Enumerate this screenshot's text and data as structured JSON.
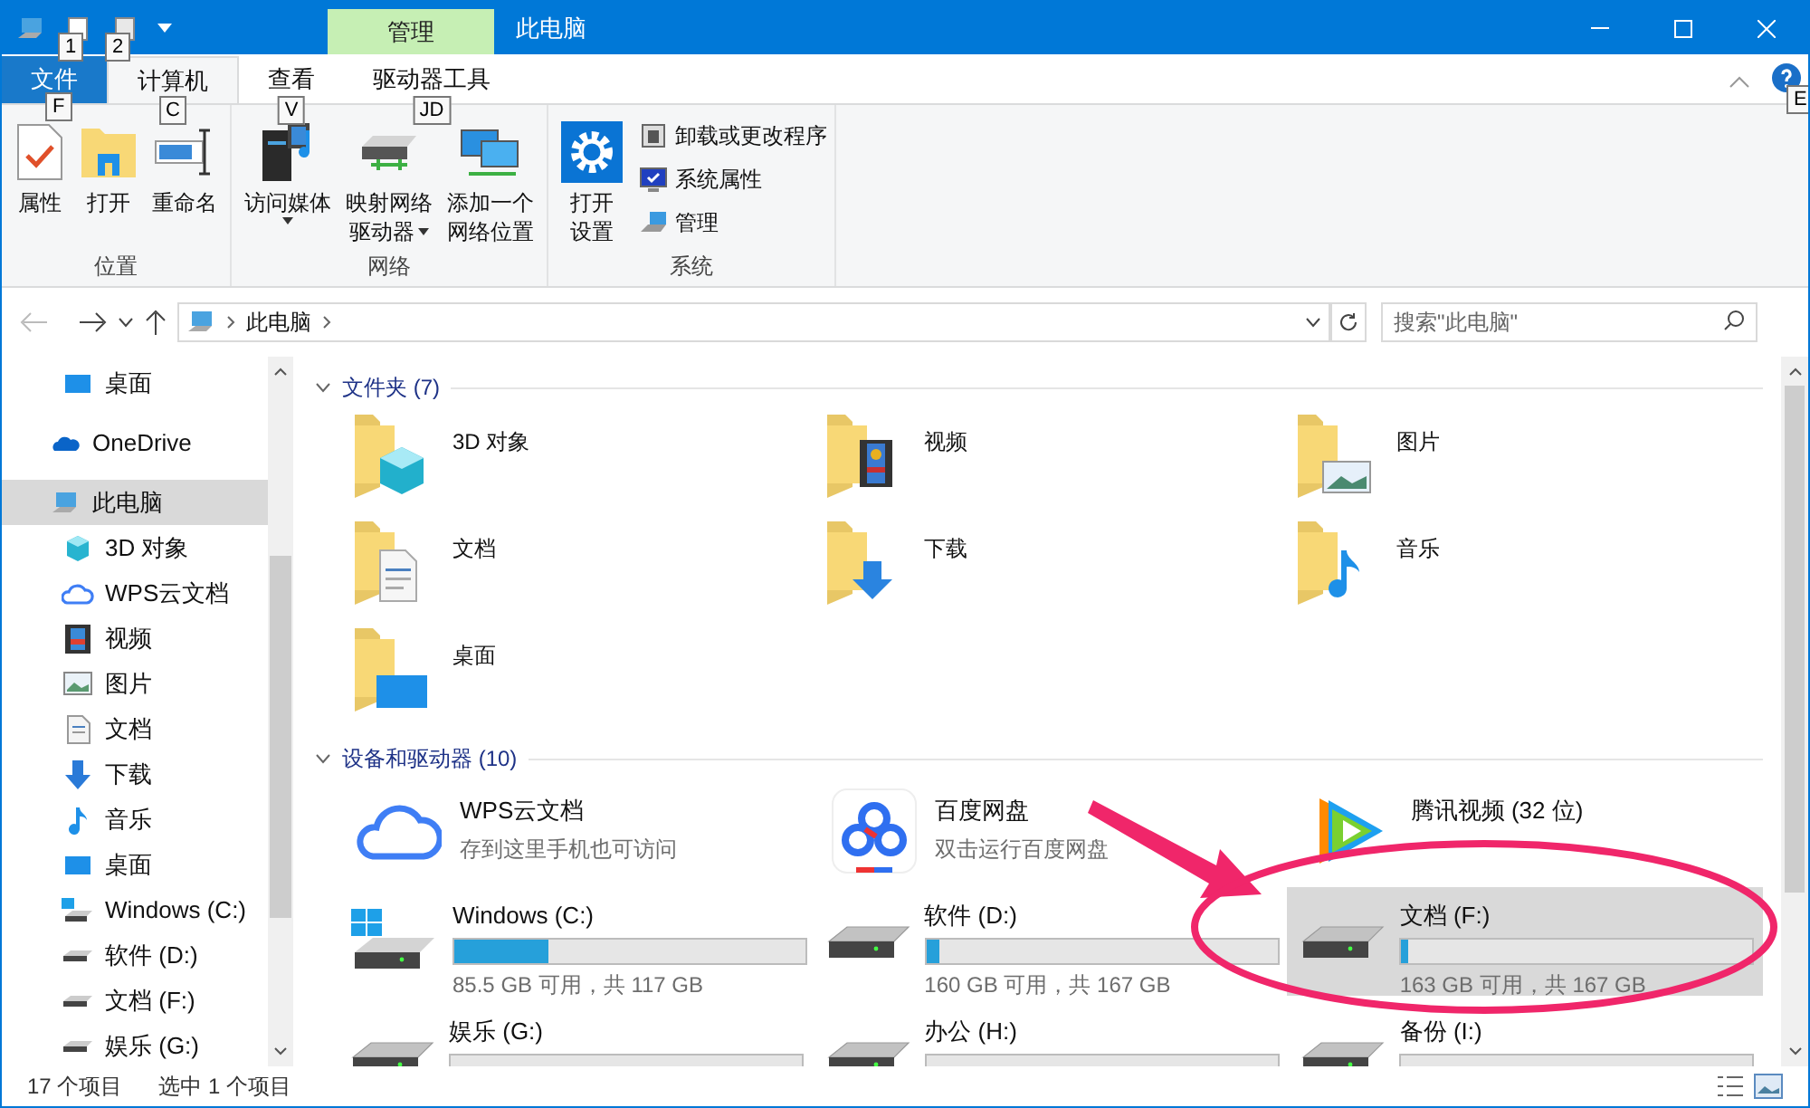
{
  "window": {
    "title": "此电脑",
    "context_tab_group": "管理"
  },
  "quick_access": [
    {
      "kind": "properties",
      "keytip": "1"
    },
    {
      "kind": "folder",
      "keytip": "2"
    }
  ],
  "tabs": [
    {
      "label": "文件",
      "kind": "file",
      "keytip": "F",
      "selected": false
    },
    {
      "label": "计算机",
      "kind": "normal",
      "keytip": "C",
      "selected": true
    },
    {
      "label": "查看",
      "kind": "normal",
      "keytip": "V",
      "selected": false
    },
    {
      "label": "驱动器工具",
      "kind": "normal",
      "keytip": "JD",
      "selected": false
    }
  ],
  "help_keytip": "E",
  "ribbon": [
    {
      "group": "位置",
      "buttons": [
        {
          "kind": "properties",
          "lines": [
            "属性"
          ],
          "dropdown": false
        },
        {
          "kind": "open",
          "lines": [
            "打开"
          ],
          "dropdown": false
        },
        {
          "kind": "rename",
          "lines": [
            "重命名"
          ],
          "dropdown": false
        }
      ]
    },
    {
      "group": "网络",
      "buttons": [
        {
          "kind": "media",
          "lines": [
            "访问媒体"
          ],
          "dropdown": true
        },
        {
          "kind": "mapdrive",
          "lines": [
            "映射网络",
            "驱动器"
          ],
          "dropdown": true
        },
        {
          "kind": "network",
          "lines": [
            "添加一个",
            "网络位置"
          ],
          "dropdown": false
        }
      ]
    },
    {
      "group": "系统",
      "buttons": [
        {
          "kind": "settings",
          "lines": [
            "打开",
            "设置"
          ],
          "dropdown": false
        }
      ],
      "small_buttons": [
        {
          "kind": "uninstall",
          "label": "卸载或更改程序"
        },
        {
          "kind": "system",
          "label": "系统属性"
        },
        {
          "kind": "manage",
          "label": "管理"
        }
      ]
    }
  ],
  "address": {
    "path": [
      "此电脑"
    ],
    "search_placeholder": "搜索\"此电脑\""
  },
  "sidebar": [
    {
      "label": "桌面",
      "kind": "desktop",
      "selected": false
    },
    {
      "label": "OneDrive",
      "kind": "onedrive",
      "selected": false
    },
    {
      "label": "此电脑",
      "kind": "pc",
      "selected": true,
      "children": [
        {
          "label": "3D 对象",
          "kind": "objects",
          "selected": false
        },
        {
          "label": "WPS云文档",
          "kind": "wps",
          "selected": false
        },
        {
          "label": "视频",
          "kind": "video",
          "selected": false
        },
        {
          "label": "图片",
          "kind": "pictures",
          "selected": false
        },
        {
          "label": "文档",
          "kind": "documents",
          "selected": false
        },
        {
          "label": "下载",
          "kind": "downloads",
          "selected": false
        },
        {
          "label": "音乐",
          "kind": "music",
          "selected": false
        },
        {
          "label": "桌面",
          "kind": "desktop",
          "selected": false
        },
        {
          "label": "Windows (C:)",
          "kind": "windrive",
          "selected": false
        },
        {
          "label": "软件 (D:)",
          "kind": "drive",
          "selected": false
        },
        {
          "label": "文档 (F:)",
          "kind": "drive",
          "selected": false
        },
        {
          "label": "娱乐 (G:)",
          "kind": "drive",
          "selected": false
        }
      ]
    }
  ],
  "folders_heading": "文件夹 (7)",
  "folders": [
    {
      "label": "3D 对象",
      "kind": "objects"
    },
    {
      "label": "视频",
      "kind": "video"
    },
    {
      "label": "图片",
      "kind": "pictures"
    },
    {
      "label": "文档",
      "kind": "documents"
    },
    {
      "label": "下载",
      "kind": "downloads"
    },
    {
      "label": "音乐",
      "kind": "music"
    },
    {
      "label": "桌面",
      "kind": "desktop"
    }
  ],
  "devices_heading": "设备和驱动器 (10)",
  "devices": [
    {
      "kind": "wps",
      "name": "WPS云文档",
      "detail": "存到这里手机也可访问",
      "selected": false
    },
    {
      "kind": "baidu",
      "name": "百度网盘",
      "detail": "双击运行百度网盘",
      "selected": false
    },
    {
      "kind": "tencent",
      "name": "腾讯视频 (32 位)",
      "selected": false
    },
    {
      "kind": "windrive",
      "name": "Windows (C:)",
      "level": 0.27,
      "detail": "85.5 GB 可用，共 117 GB",
      "selected": false
    },
    {
      "kind": "drive",
      "name": "软件 (D:)",
      "level": 0.04,
      "detail": "160 GB 可用，共 167 GB",
      "selected": false
    },
    {
      "kind": "drive",
      "name": "文档 (F:)",
      "level": 0.02,
      "detail": "163 GB 可用，共 167 GB",
      "selected": true
    },
    {
      "kind": "drive",
      "name": "娱乐 (G:)",
      "selected": false
    },
    {
      "kind": "drive",
      "name": "办公 (H:)",
      "selected": false
    },
    {
      "kind": "drive",
      "name": "备份 (I:)",
      "selected": false
    }
  ],
  "status_bar": {
    "count": "17 个项目",
    "selection": "选中 1 个项目"
  }
}
